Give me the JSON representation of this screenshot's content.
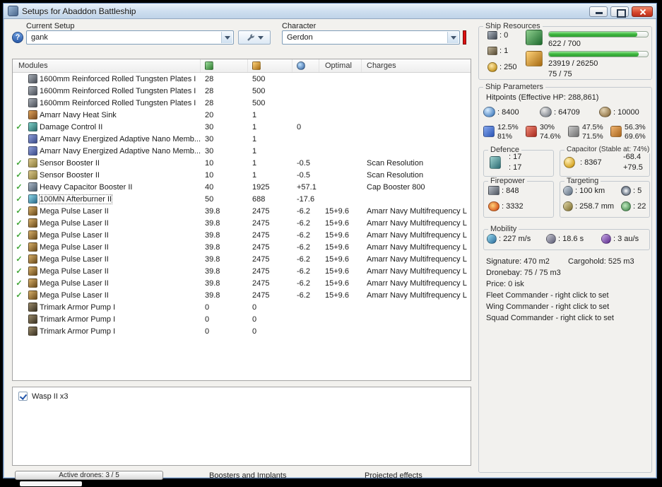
{
  "window": {
    "title": "Setups for Abaddon Battleship"
  },
  "toolbar": {
    "current_setup_label": "Current Setup",
    "setup_value": "gank",
    "character_label": "Character",
    "character_value": "Gerdon"
  },
  "modules_table": {
    "headers": {
      "modules": "Modules",
      "optimal": "Optimal",
      "charges": "Charges"
    },
    "check_glyph": "✓",
    "rows": [
      {
        "active": false,
        "icon": "armor-plate-icon",
        "name": "1600mm Reinforced Rolled Tungsten Plates I",
        "cpu": "28",
        "pg": "500"
      },
      {
        "active": false,
        "icon": "armor-plate-icon",
        "name": "1600mm Reinforced Rolled Tungsten Plates I",
        "cpu": "28",
        "pg": "500"
      },
      {
        "active": false,
        "icon": "armor-plate-icon",
        "name": "1600mm Reinforced Rolled Tungsten Plates I",
        "cpu": "28",
        "pg": "500"
      },
      {
        "active": false,
        "icon": "heat-sink-icon",
        "name": "Amarr Navy Heat Sink",
        "cpu": "20",
        "pg": "1"
      },
      {
        "active": true,
        "icon": "damage-control-icon",
        "name": "Damage Control II",
        "cpu": "30",
        "pg": "1",
        "cap": "0"
      },
      {
        "active": false,
        "icon": "nano-membrane-icon",
        "name": "Amarr Navy Energized Adaptive Nano Memb...",
        "cpu": "30",
        "pg": "1"
      },
      {
        "active": false,
        "icon": "nano-membrane-icon",
        "name": "Amarr Navy Energized Adaptive Nano Memb...",
        "cpu": "30",
        "pg": "1"
      },
      {
        "active": true,
        "icon": "sensor-booster-icon",
        "name": "Sensor Booster II",
        "cpu": "10",
        "pg": "1",
        "cap": "-0.5",
        "charges": "Scan Resolution"
      },
      {
        "active": true,
        "icon": "sensor-booster-icon",
        "name": "Sensor Booster II",
        "cpu": "10",
        "pg": "1",
        "cap": "-0.5",
        "charges": "Scan Resolution"
      },
      {
        "active": true,
        "icon": "cap-booster-icon",
        "name": "Heavy Capacitor Booster II",
        "cpu": "40",
        "pg": "1925",
        "cap": "+57.1",
        "charges": "Cap Booster 800"
      },
      {
        "active": true,
        "icon": "afterburner-icon",
        "name": "100MN Afterburner II",
        "cpu": "50",
        "pg": "688",
        "cap": "-17.6",
        "selected": true
      },
      {
        "active": true,
        "icon": "pulse-laser-icon",
        "name": "Mega Pulse Laser II",
        "cpu": "39.8",
        "pg": "2475",
        "cap": "-6.2",
        "optimal": "15+9.6",
        "charges": "Amarr Navy Multifrequency L"
      },
      {
        "active": true,
        "icon": "pulse-laser-icon",
        "name": "Mega Pulse Laser II",
        "cpu": "39.8",
        "pg": "2475",
        "cap": "-6.2",
        "optimal": "15+9.6",
        "charges": "Amarr Navy Multifrequency L"
      },
      {
        "active": true,
        "icon": "pulse-laser-icon",
        "name": "Mega Pulse Laser II",
        "cpu": "39.8",
        "pg": "2475",
        "cap": "-6.2",
        "optimal": "15+9.6",
        "charges": "Amarr Navy Multifrequency L"
      },
      {
        "active": true,
        "icon": "pulse-laser-icon",
        "name": "Mega Pulse Laser II",
        "cpu": "39.8",
        "pg": "2475",
        "cap": "-6.2",
        "optimal": "15+9.6",
        "charges": "Amarr Navy Multifrequency L"
      },
      {
        "active": true,
        "icon": "pulse-laser-icon",
        "name": "Mega Pulse Laser II",
        "cpu": "39.8",
        "pg": "2475",
        "cap": "-6.2",
        "optimal": "15+9.6",
        "charges": "Amarr Navy Multifrequency L"
      },
      {
        "active": true,
        "icon": "pulse-laser-icon",
        "name": "Mega Pulse Laser II",
        "cpu": "39.8",
        "pg": "2475",
        "cap": "-6.2",
        "optimal": "15+9.6",
        "charges": "Amarr Navy Multifrequency L"
      },
      {
        "active": true,
        "icon": "pulse-laser-icon",
        "name": "Mega Pulse Laser II",
        "cpu": "39.8",
        "pg": "2475",
        "cap": "-6.2",
        "optimal": "15+9.6",
        "charges": "Amarr Navy Multifrequency L"
      },
      {
        "active": true,
        "icon": "pulse-laser-icon",
        "name": "Mega Pulse Laser II",
        "cpu": "39.8",
        "pg": "2475",
        "cap": "-6.2",
        "optimal": "15+9.6",
        "charges": "Amarr Navy Multifrequency L"
      },
      {
        "active": false,
        "icon": "rig-icon",
        "name": "Trimark Armor Pump I",
        "cpu": "0",
        "pg": "0"
      },
      {
        "active": false,
        "icon": "rig-icon",
        "name": "Trimark Armor Pump I",
        "cpu": "0",
        "pg": "0"
      },
      {
        "active": false,
        "icon": "rig-icon",
        "name": "Trimark Armor Pump I",
        "cpu": "0",
        "pg": "0"
      }
    ]
  },
  "drones_panel": {
    "items": [
      {
        "checked": true,
        "label": "Wasp II x3"
      }
    ]
  },
  "bottom_bar": {
    "active_drones_label": "Active drones: 3 / 5",
    "boosters_tab": "Boosters and Implants",
    "projected_tab": "Projected effects"
  },
  "ship_resources": {
    "title": "Ship Resources",
    "turret_hardpoints": ": 0",
    "launcher_hardpoints": ": 1",
    "calibration": ": 250",
    "cpu_text": "622 / 700",
    "cpu_pct": 89,
    "powergrid_text": "23919 / 26250",
    "powergrid_pct": 91,
    "dronebay_text": "75 / 75"
  },
  "ship_parameters": {
    "title": "Ship Parameters",
    "hitpoints_label": "Hitpoints (Effective HP: 288,861)",
    "shield_hp": ": 8400",
    "armor_hp": ": 64709",
    "structure_hp": ": 10000",
    "resists": [
      {
        "top": "12.5%",
        "bottom": "81%"
      },
      {
        "top": "30%",
        "bottom": "74.6%"
      },
      {
        "top": "47.5%",
        "bottom": "71.5%"
      },
      {
        "top": "56.3%",
        "bottom": "69.6%"
      }
    ],
    "defence": {
      "label": "Defence",
      "value1": ": 17",
      "value2": ": 17"
    },
    "capacitor": {
      "label": "Capacitor (Stable at: 74%)",
      "amount": ": 8367",
      "drain": "-68.4",
      "recharge": "+79.5"
    },
    "firepower": {
      "label": "Firepower",
      "dps": ": 848",
      "volley": ": 3332"
    },
    "targeting": {
      "label": "Targeting",
      "range": ": 100 km",
      "max_targets": ": 5",
      "scan_resolution": ": 258.7 mm",
      "sensor_strength": ": 22"
    },
    "mobility": {
      "label": "Mobility",
      "speed": ": 227 m/s",
      "align_time": ": 18.6 s",
      "warp_speed": ": 3 au/s"
    },
    "info": {
      "signature": "Signature: 470 m2",
      "cargohold": "Cargohold: 525 m3",
      "dronebay": "Dronebay: 75 / 75 m3",
      "price": "Price: 0 isk",
      "fleet_commander": "Fleet Commander - right click to set",
      "wing_commander": "Wing Commander - right click to set",
      "squad_commander": "Squad Commander - right click to set"
    }
  },
  "colors": {
    "bar_green": "#3db53d",
    "close_button_red": "#d0382f",
    "check_green": "#3fa535",
    "resist_em": "#2a54b4",
    "resist_thermal": "#a8281c",
    "resist_kinetic": "#6e6e6e",
    "resist_explosive": "#a8651c"
  }
}
